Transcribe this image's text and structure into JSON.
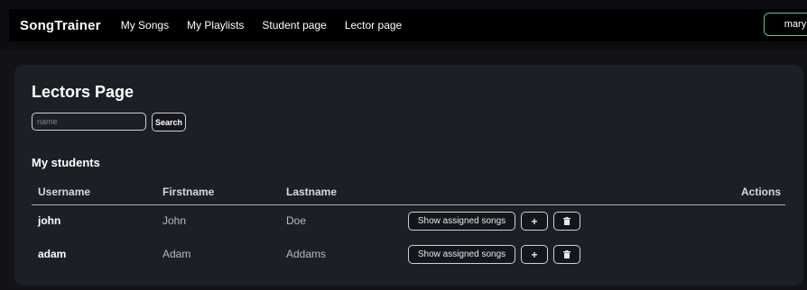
{
  "nav": {
    "brand": "SongTrainer",
    "links": [
      "My Songs",
      "My Playlists",
      "Student page",
      "Lector page"
    ],
    "user": "mary"
  },
  "page": {
    "title": "Lectors Page",
    "search": {
      "placeholder": "name",
      "button": "Search"
    },
    "students_title": "My students"
  },
  "table": {
    "headers": {
      "username": "Username",
      "firstname": "Firstname",
      "lastname": "Lastname",
      "actions": "Actions"
    },
    "rows": [
      {
        "username": "john",
        "firstname": "John",
        "lastname": "Doe",
        "show_label": "Show assigned songs"
      },
      {
        "username": "adam",
        "firstname": "Adam",
        "lastname": "Addams",
        "show_label": "Show assigned songs"
      }
    ]
  },
  "icons": {
    "add": "plus-icon",
    "delete": "trash-icon"
  },
  "colors": {
    "accent": "#3ecfa0",
    "panel": "#1d1f26",
    "background": "#121317"
  }
}
